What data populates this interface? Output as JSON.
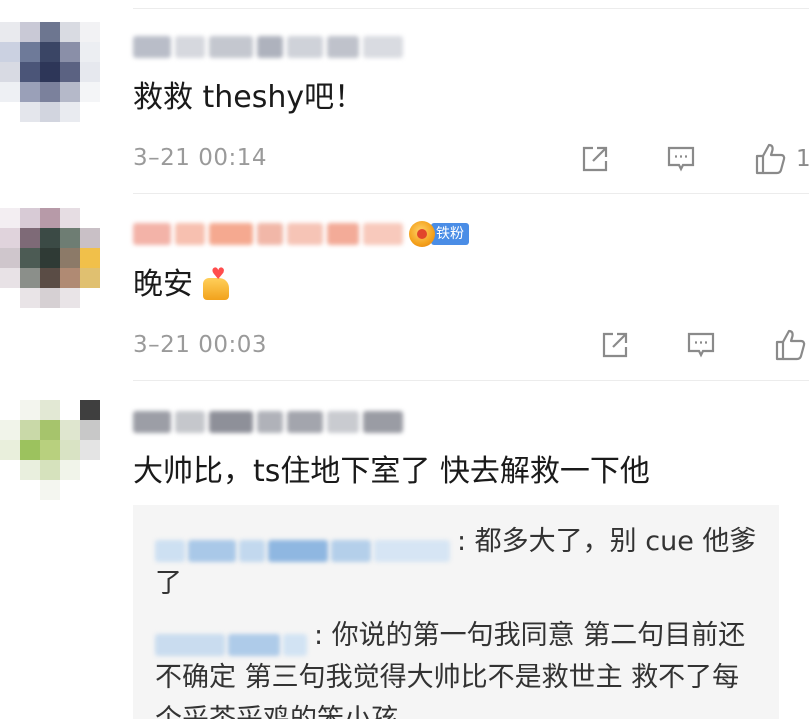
{
  "comments": [
    {
      "content": "救救 theshy吧！",
      "time": "3–21 00:14",
      "like_count": "1",
      "avatar_colors": [
        "#e9eaee",
        "#c9c9d6",
        "#6d7690",
        "#d9dbe2",
        "#f2f2f4",
        "#cbd1e1",
        "#6e7a99",
        "#3a4565",
        "#8a8fa8",
        "#eceef2",
        "#d8dae3",
        "#4b5578",
        "#2d3658",
        "#5b6282",
        "#e6e8ee",
        "#eef0f4",
        "#9aa0b8",
        "#7b819c",
        "#b5b9c9",
        "#f4f5f7",
        "#ffffff",
        "#e4e6ec",
        "#d2d5df",
        "#e9ebf0",
        "#ffffff"
      ],
      "name_blur": [
        "#b9bdc8",
        "#d6d8de",
        "#c4c7cf",
        "#aeb2bd",
        "#cfd2d9",
        "#bfc2cb",
        "#d9dbe1"
      ]
    },
    {
      "content": "晚安",
      "time": "3–21 00:03",
      "badge": "铁粉",
      "avatar_colors": [
        "#f3eef2",
        "#d8cbd6",
        "#b79aa8",
        "#e6dde3",
        "#ffffff",
        "#e0d3dc",
        "#7e6a77",
        "#3b4a45",
        "#6e7d73",
        "#c9c0c6",
        "#cfc6cc",
        "#4c5b54",
        "#2f3a35",
        "#8c7a68",
        "#f1c04a",
        "#e8e2e6",
        "#8b8f8a",
        "#5a4c45",
        "#b08a73",
        "#e0c070",
        "#ffffff",
        "#e9e4e7",
        "#d6d0d3",
        "#e9e4e7",
        "#ffffff"
      ],
      "name_blur": [
        "#f3b3a8",
        "#f7c0b0",
        "#f5a990",
        "#f1b7a8",
        "#f6c4b6",
        "#f3ab98",
        "#f8c9bc"
      ]
    },
    {
      "content": "大帅比，ts住地下室了 快去解救一下他",
      "avatar_colors": [
        "#ffffff",
        "#f3f5ee",
        "#e2e8d4",
        "#ffffff",
        "#3f3f3f",
        "#f1f4ea",
        "#c9d9a8",
        "#a6c46c",
        "#dfe6cf",
        "#c8c8c8",
        "#e9efdc",
        "#9cc25e",
        "#b8d07e",
        "#d9e3c4",
        "#e4e4e4",
        "#ffffff",
        "#e9efde",
        "#d6e2bd",
        "#f1f4ea",
        "#ffffff",
        "#ffffff",
        "#ffffff",
        "#f4f6f0",
        "#ffffff",
        "#ffffff"
      ],
      "name_blur": [
        "#9c9ea6",
        "#c5c7cc",
        "#8e9099",
        "#b0b2b9",
        "#a3a5ad",
        "#c9cbd0",
        "#9a9ca4"
      ]
    }
  ],
  "replies": [
    {
      "text": ": 都多大了，别 cue 他爹了",
      "name_blur": [
        "#cde0f2",
        "#a9c8e8",
        "#c2d8ee",
        "#8fb7e1",
        "#b4cfea",
        "#d6e5f4"
      ]
    },
    {
      "text": ": 你说的第一句我同意 第二句目前还不确定 第三句我觉得大帅比不是救世主 救不了每个采茶采鸡的笨小孩",
      "name_blur": [
        "#c9dcef",
        "#aecbe9",
        "#d2e3f3"
      ]
    }
  ],
  "colors": {
    "meta": "#9a9a9a",
    "badge": "#4a8de6",
    "reply_bg": "#f5f5f5"
  },
  "icons": [
    "share-icon",
    "comment-icon",
    "like-icon"
  ]
}
